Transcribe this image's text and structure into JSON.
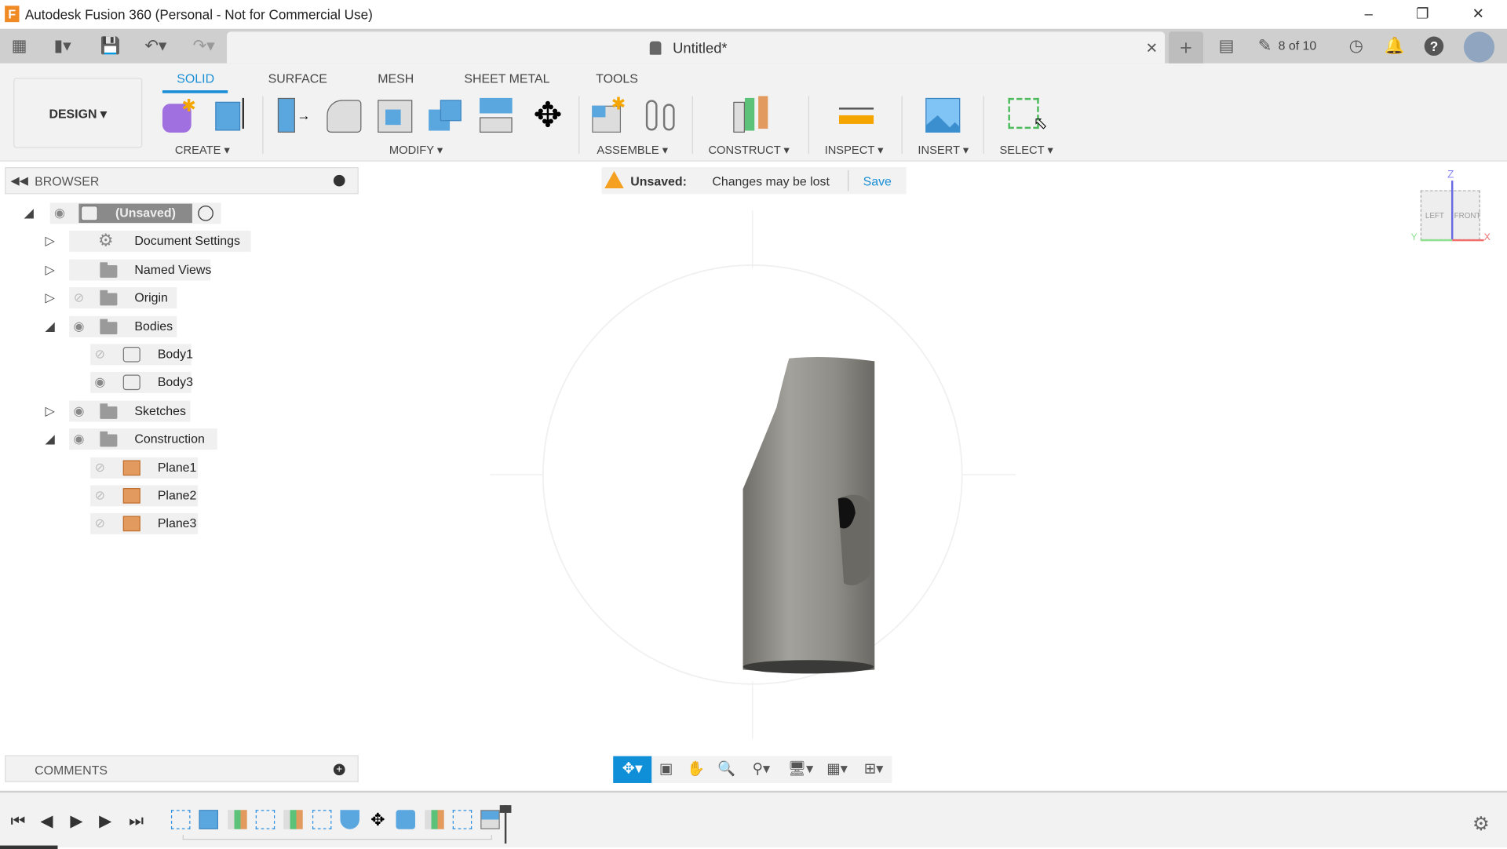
{
  "window": {
    "title": "Autodesk Fusion 360 (Personal - Not for Commercial Use)",
    "app_icon": "F",
    "controls": [
      "minimize",
      "restore",
      "close"
    ]
  },
  "quickbar": {
    "doc_title": "Untitled*",
    "job_status": "8 of 10",
    "icons": [
      "grid-icon",
      "file-icon",
      "save-icon",
      "undo-icon",
      "redo-icon"
    ]
  },
  "ribbon": {
    "workspace": "DESIGN",
    "tabs": [
      {
        "label": "SOLID",
        "active": true
      },
      {
        "label": "SURFACE"
      },
      {
        "label": "MESH"
      },
      {
        "label": "SHEET METAL"
      },
      {
        "label": "TOOLS"
      }
    ],
    "groups": [
      "CREATE",
      "MODIFY",
      "ASSEMBLE",
      "CONSTRUCT",
      "INSPECT",
      "INSERT",
      "SELECT"
    ],
    "accent": "#1b8fd6"
  },
  "browser": {
    "title": "BROWSER",
    "items": [
      {
        "label": "(Unsaved)",
        "level": 0,
        "expanded": true,
        "icon": "component",
        "visible": true
      },
      {
        "label": "Document Settings",
        "level": 1,
        "expanded": false,
        "icon": "gear"
      },
      {
        "label": "Named Views",
        "level": 1,
        "expanded": false,
        "icon": "folder"
      },
      {
        "label": "Origin",
        "level": 1,
        "expanded": false,
        "icon": "folder",
        "visible": false
      },
      {
        "label": "Bodies",
        "level": 1,
        "expanded": true,
        "icon": "folder",
        "visible": true
      },
      {
        "label": "Body1",
        "level": 2,
        "icon": "body",
        "visible": false
      },
      {
        "label": "Body3",
        "level": 2,
        "icon": "body",
        "visible": true
      },
      {
        "label": "Sketches",
        "level": 1,
        "expanded": false,
        "icon": "folder",
        "visible": true
      },
      {
        "label": "Construction",
        "level": 1,
        "expanded": true,
        "icon": "folder",
        "visible": true
      },
      {
        "label": "Plane1",
        "level": 2,
        "icon": "plane",
        "visible": false
      },
      {
        "label": "Plane2",
        "level": 2,
        "icon": "plane",
        "visible": false
      },
      {
        "label": "Plane3",
        "level": 2,
        "icon": "plane",
        "visible": false
      }
    ]
  },
  "banner": {
    "status": "Unsaved:",
    "message": "Changes may be lost",
    "action": "Save"
  },
  "viewcube": {
    "left": "LEFT",
    "front": "FRONT",
    "axes": [
      "X",
      "Y",
      "Z"
    ]
  },
  "comments": {
    "title": "COMMENTS"
  },
  "timeline": {
    "features": [
      "sketch",
      "extrude",
      "plane",
      "sketch",
      "plane",
      "sketch",
      "hole",
      "move",
      "combine",
      "plane",
      "sketch",
      "press-pull"
    ]
  }
}
